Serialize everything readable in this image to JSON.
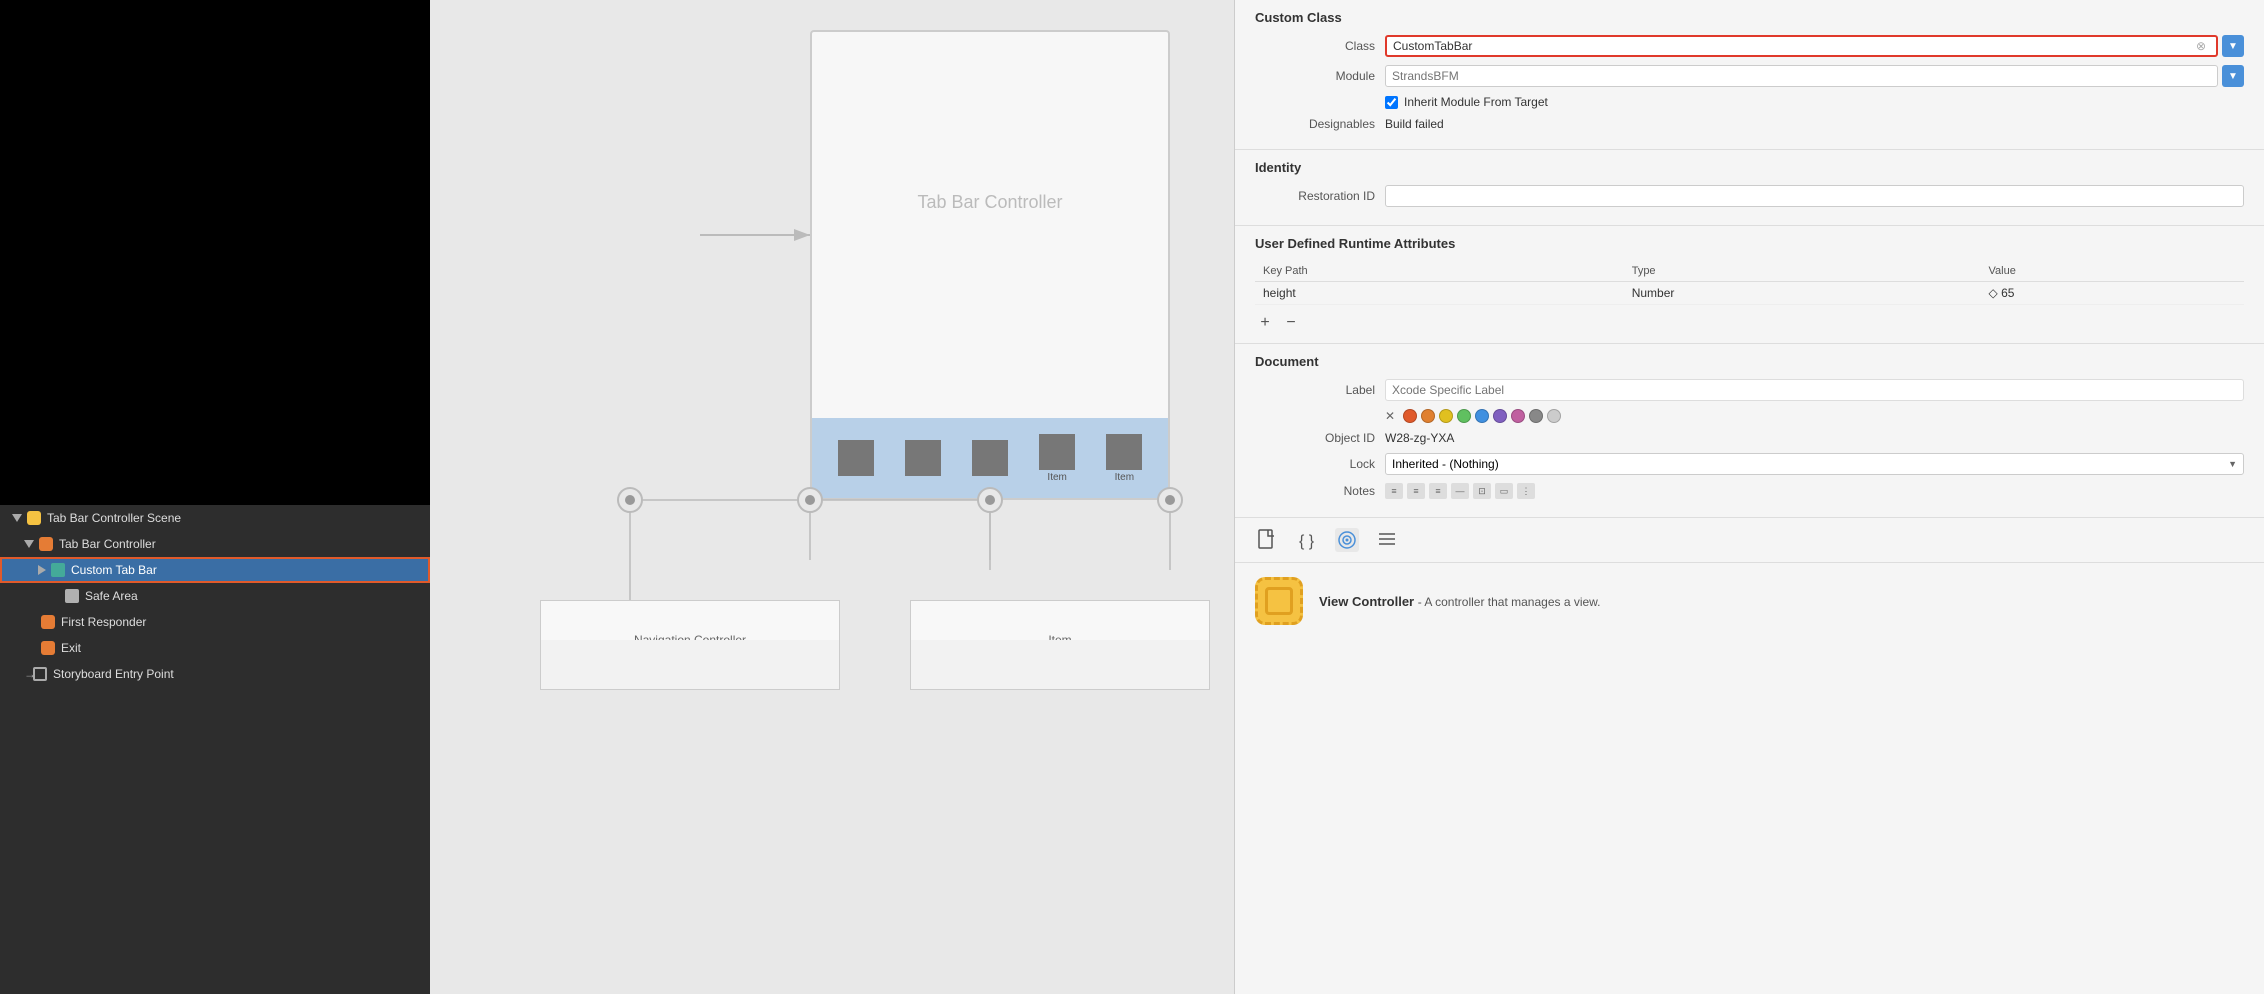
{
  "leftPanel": {
    "outlineItems": [
      {
        "id": "scene",
        "label": "Tab Bar Controller Scene",
        "indent": 0,
        "iconType": "scene",
        "expanded": true,
        "hasDisclosure": true
      },
      {
        "id": "tabbar",
        "label": "Tab Bar Controller",
        "indent": 1,
        "iconType": "tabbar",
        "expanded": true,
        "hasDisclosure": true
      },
      {
        "id": "customtabbar",
        "label": "Custom Tab Bar",
        "indent": 2,
        "iconType": "customtabbar",
        "expanded": false,
        "hasDisclosure": true,
        "selected": true
      },
      {
        "id": "safearea",
        "label": "Safe Area",
        "indent": 3,
        "iconType": "safearea",
        "expanded": false,
        "hasDisclosure": false
      },
      {
        "id": "firstresponder",
        "label": "First Responder",
        "indent": 1,
        "iconType": "firstresponder",
        "expanded": false,
        "hasDisclosure": false
      },
      {
        "id": "exit",
        "label": "Exit",
        "indent": 1,
        "iconType": "exit",
        "expanded": false,
        "hasDisclosure": false
      },
      {
        "id": "entrypoint",
        "label": "Storyboard Entry Point",
        "indent": 1,
        "iconType": "entrypoint",
        "expanded": false,
        "hasDisclosure": false
      }
    ]
  },
  "canvas": {
    "deviceTitle": "Tab Bar Controller",
    "tabItems": [
      "",
      "",
      "",
      "Item",
      "Item"
    ],
    "navControllerLabel": "Navigation Controller",
    "itemLabel": "Item"
  },
  "rightPanel": {
    "customClass": {
      "sectionTitle": "Custom Class",
      "classLabel": "Class",
      "classValue": "CustomTabBar",
      "moduleLabel": "Module",
      "moduleValue": "StrandsBFM",
      "inheritCheckboxLabel": "Inherit Module From Target",
      "designablesLabel": "Designables",
      "designablesValue": "Build failed"
    },
    "identity": {
      "sectionTitle": "Identity",
      "restorationIdLabel": "Restoration ID",
      "restorationIdValue": ""
    },
    "udra": {
      "sectionTitle": "User Defined Runtime Attributes",
      "columns": [
        "Key Path",
        "Type",
        "Value"
      ],
      "rows": [
        {
          "keyPath": "height",
          "type": "Number",
          "value": "◇ 65"
        }
      ]
    },
    "document": {
      "sectionTitle": "Document",
      "labelFieldLabel": "Label",
      "labelPlaceholder": "Xcode Specific Label",
      "objectIdLabel": "Object ID",
      "objectIdValue": "W28-zg-YXA",
      "lockLabel": "Lock",
      "lockValue": "Inherited - (Nothing)",
      "notesLabel": "Notes",
      "colors": [
        "#e05a2b",
        "#e08030",
        "#e0c020",
        "#60c060",
        "#4090e0",
        "#8060c0",
        "#c060a0",
        "#808080",
        "#c0c0c0"
      ]
    },
    "viewController": {
      "title": "View Controller",
      "description": "- A controller that manages a view."
    }
  }
}
